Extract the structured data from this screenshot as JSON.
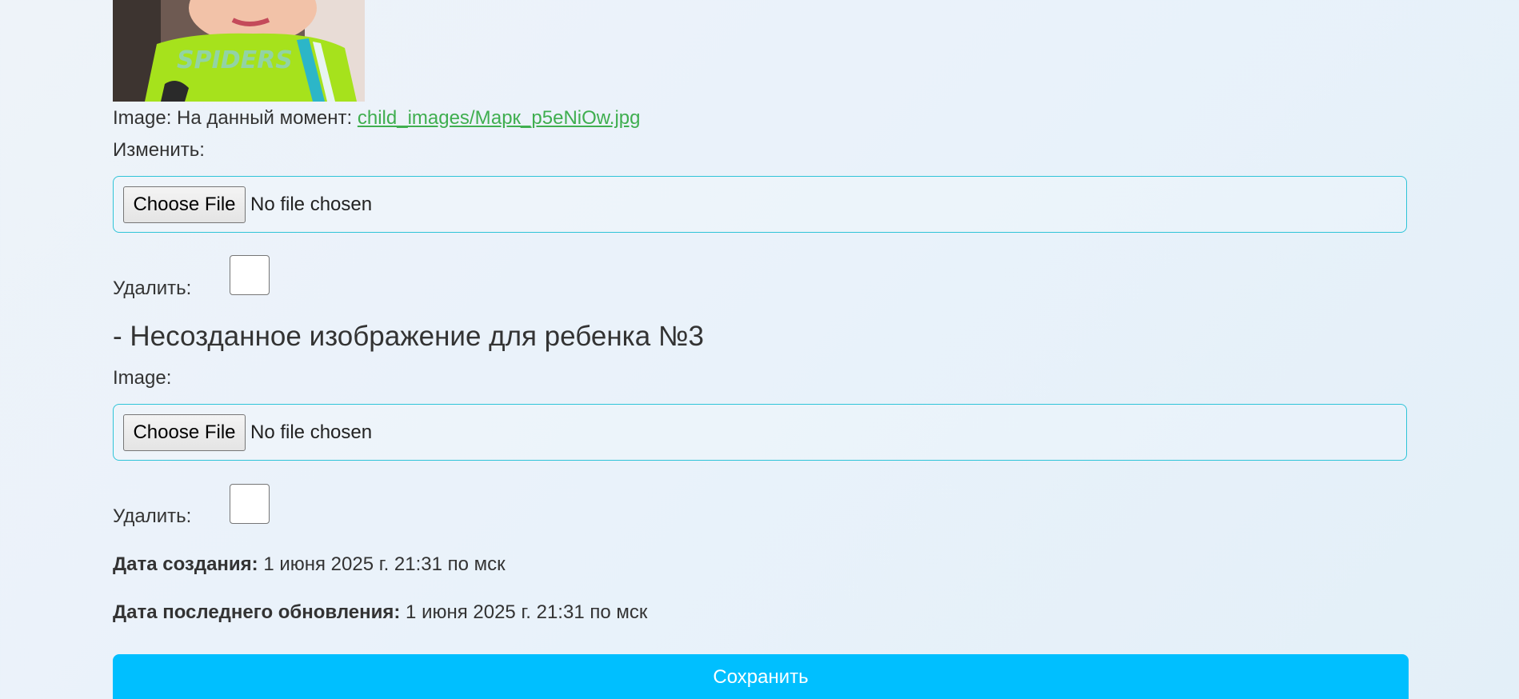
{
  "current_image": {
    "label": "Image:",
    "current_prefix": "На данный момент:",
    "current_link": "child_images/Марк_p5eNiOw.jpg",
    "change_label": "Изменить:",
    "choose_file_button": "Choose File",
    "no_file_text": "No file chosen",
    "delete_label": "Удалить:"
  },
  "new_image_section": {
    "heading": "- Несозданное изображение для ребенка №3",
    "image_label": "Image:",
    "choose_file_button": "Choose File",
    "no_file_text": "No file chosen",
    "delete_label": "Удалить:"
  },
  "meta": {
    "created_label": "Дата создания:",
    "created_value": "1 июня 2025 г. 21:31 по мск",
    "updated_label": "Дата последнего обновления:",
    "updated_value": "1 июня 2025 г. 21:31 по мск"
  },
  "save_button": "Сохранить",
  "colors": {
    "link": "#3fae4f",
    "file_box_border": "#2fc4d8",
    "save_button_bg": "#00bfff"
  }
}
